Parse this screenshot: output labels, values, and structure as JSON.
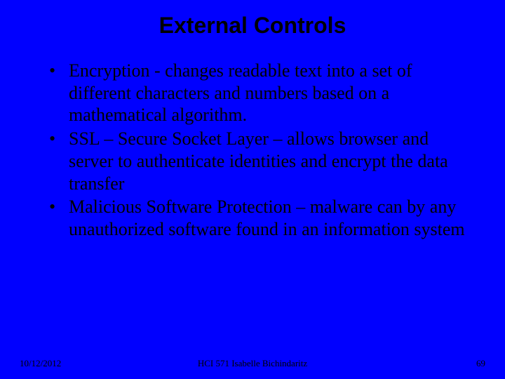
{
  "title": "External Controls",
  "bullets": [
    "Encryption - changes readable text into a set of different characters and numbers based on a mathematical algorithm.",
    "SSL – Secure Socket Layer – allows browser and server to authenticate identities and encrypt the data transfer",
    "Malicious Software Protection – malware can by any unauthorized software found in an information system"
  ],
  "footer": {
    "date": "10/12/2012",
    "center": "HCI 571   Isabelle Bichindaritz",
    "page": "69"
  }
}
